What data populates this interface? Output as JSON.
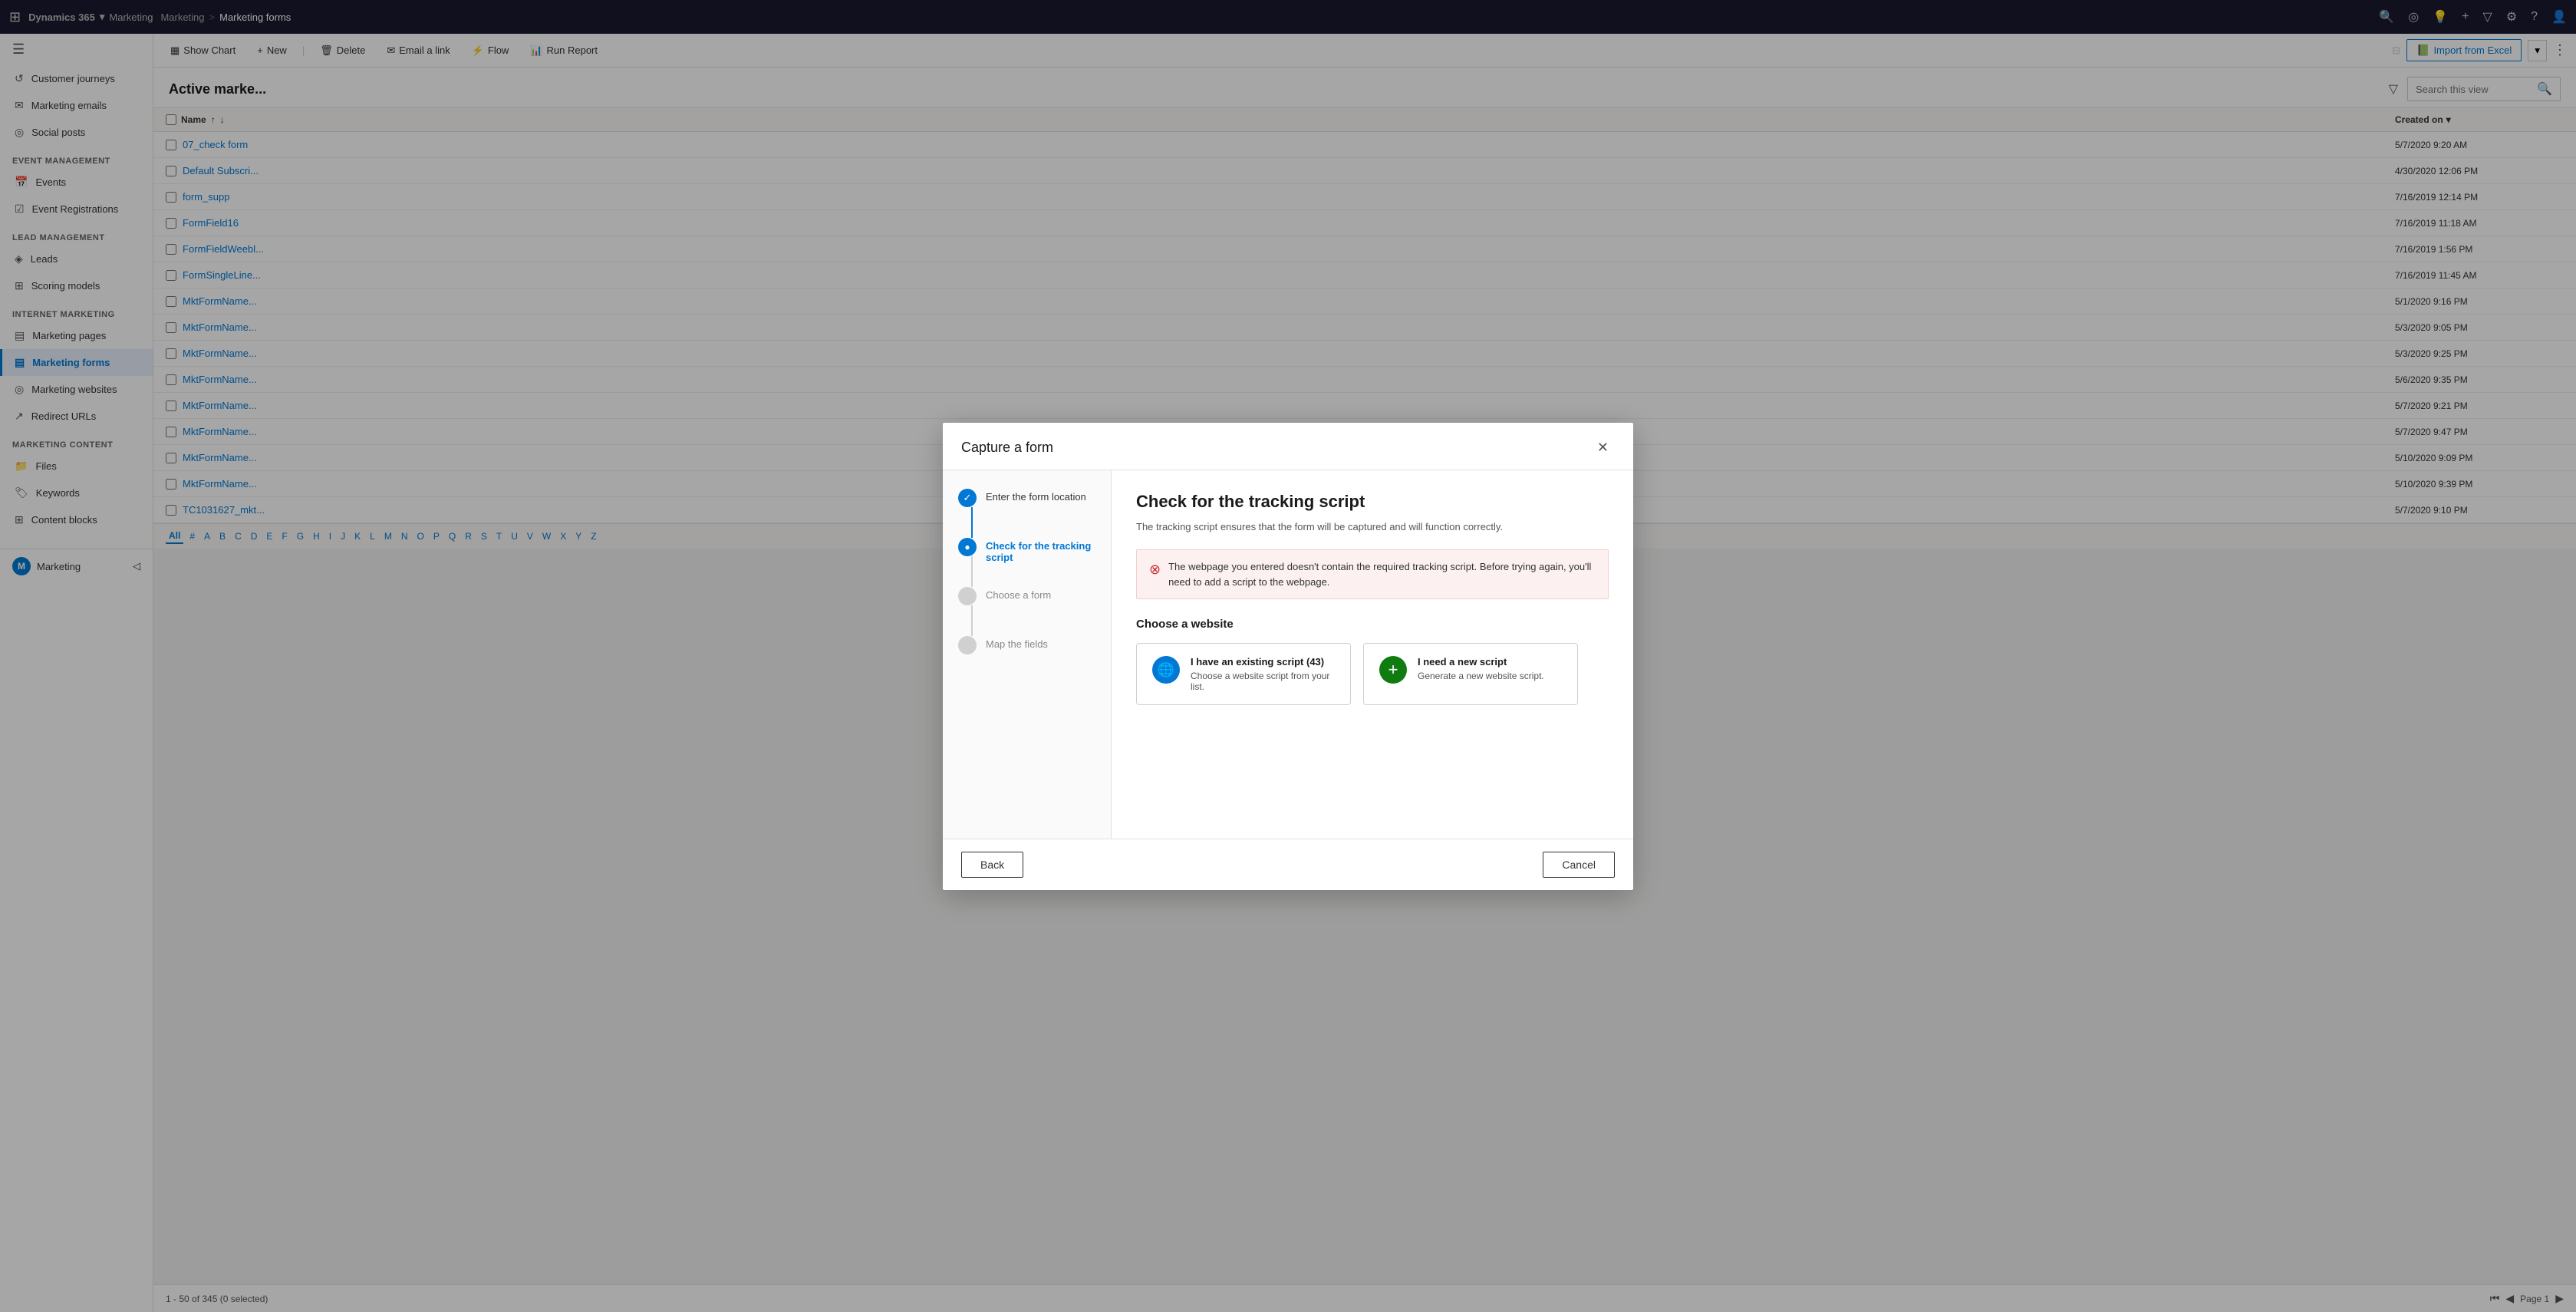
{
  "topnav": {
    "brand": "Dynamics 365",
    "module": "Marketing",
    "breadcrumb_parent": "Marketing",
    "breadcrumb_sep": ">",
    "breadcrumb_current": "Marketing forms"
  },
  "sidebar": {
    "hamburger_label": "☰",
    "sections": [
      {
        "title": "",
        "items": [
          {
            "id": "customer-journeys",
            "icon": "↺",
            "label": "Customer journeys",
            "active": false
          },
          {
            "id": "marketing-emails",
            "icon": "✉",
            "label": "Marketing emails",
            "active": false
          },
          {
            "id": "social-posts",
            "icon": "◎",
            "label": "Social posts",
            "active": false
          }
        ]
      },
      {
        "title": "Event management",
        "items": [
          {
            "id": "events",
            "icon": "📅",
            "label": "Events",
            "active": false
          },
          {
            "id": "event-registrations",
            "icon": "☑",
            "label": "Event Registrations",
            "active": false
          }
        ]
      },
      {
        "title": "Lead management",
        "items": [
          {
            "id": "leads",
            "icon": "◈",
            "label": "Leads",
            "active": false
          },
          {
            "id": "scoring-models",
            "icon": "⊞",
            "label": "Scoring models",
            "active": false
          }
        ]
      },
      {
        "title": "Internet marketing",
        "items": [
          {
            "id": "marketing-pages",
            "icon": "▤",
            "label": "Marketing pages",
            "active": false
          },
          {
            "id": "marketing-forms",
            "icon": "▤",
            "label": "Marketing forms",
            "active": true
          },
          {
            "id": "marketing-websites",
            "icon": "◎",
            "label": "Marketing websites",
            "active": false
          },
          {
            "id": "redirect-urls",
            "icon": "↗",
            "label": "Redirect URLs",
            "active": false
          }
        ]
      },
      {
        "title": "Marketing content",
        "items": [
          {
            "id": "files",
            "icon": "📁",
            "label": "Files",
            "active": false
          },
          {
            "id": "keywords",
            "icon": "🏷",
            "label": "Keywords",
            "active": false
          },
          {
            "id": "content-blocks",
            "icon": "⊞",
            "label": "Content blocks",
            "active": false
          }
        ]
      }
    ]
  },
  "toolbar": {
    "show_chart_label": "Show Chart",
    "new_label": "+",
    "import_excel_label": "Import from Excel"
  },
  "page": {
    "title": "Active marke...",
    "search_placeholder": "Search this view",
    "filter_label": "▽",
    "column_name": "Name",
    "column_created_on": "Created on"
  },
  "table_rows": [
    {
      "name": "07_check form",
      "date": "5/7/2020 9:20 AM"
    },
    {
      "name": "Default Subscri...",
      "date": "4/30/2020 12:06 PM"
    },
    {
      "name": "form_supp",
      "date": "7/16/2019 12:14 PM"
    },
    {
      "name": "FormField16",
      "date": "7/16/2019 11:18 AM"
    },
    {
      "name": "FormFieldWeebl...",
      "date": "7/16/2019 1:56 PM"
    },
    {
      "name": "FormSingleLine...",
      "date": "7/16/2019 11:45 AM"
    },
    {
      "name": "MktFormName...",
      "date": "5/1/2020 9:16 PM"
    },
    {
      "name": "MktFormName...",
      "date": "5/3/2020 9:05 PM"
    },
    {
      "name": "MktFormName...",
      "date": "5/3/2020 9:25 PM"
    },
    {
      "name": "MktFormName...",
      "date": "5/6/2020 9:35 PM"
    },
    {
      "name": "MktFormName...",
      "date": "5/7/2020 9:21 PM"
    },
    {
      "name": "MktFormName...",
      "date": "5/7/2020 9:47 PM"
    },
    {
      "name": "MktFormName...",
      "date": "5/10/2020 9:09 PM"
    },
    {
      "name": "MktFormName...",
      "date": "5/10/2020 9:39 PM"
    },
    {
      "name": "TC1031627_mkt...",
      "date": "5/7/2020 9:10 PM"
    }
  ],
  "alpha_nav": [
    "All",
    "#",
    "A",
    "B",
    "C",
    "D",
    "E",
    "F",
    "G",
    "H",
    "I",
    "J",
    "K",
    "L",
    "M",
    "N",
    "O",
    "P",
    "Q",
    "R",
    "S",
    "T",
    "U",
    "V",
    "W",
    "X",
    "Y",
    "Z"
  ],
  "statusbar": {
    "record_count": "1 - 50 of 345 (0 selected)",
    "page_label": "Page 1"
  },
  "modal": {
    "title": "Capture a form",
    "close_label": "✕",
    "steps": [
      {
        "id": "step-enter-location",
        "label": "Enter the form location",
        "state": "complete"
      },
      {
        "id": "step-check-tracking",
        "label": "Check for the tracking script",
        "state": "active"
      },
      {
        "id": "step-choose-form",
        "label": "Choose a form",
        "state": "inactive"
      },
      {
        "id": "step-map-fields",
        "label": "Map the fields",
        "state": "inactive"
      }
    ],
    "content": {
      "heading": "Check for the tracking script",
      "subtitle": "The tracking script ensures that the form will be captured and will function correctly.",
      "error_message": "The webpage you entered doesn't contain the required tracking script. Before trying again, you'll need to add a script to the webpage.",
      "choose_website_label": "Choose a website",
      "option1": {
        "icon": "🌐",
        "icon_type": "blue",
        "title": "I have an existing script (43)",
        "description": "Choose a website script from your list."
      },
      "option2": {
        "icon": "+",
        "icon_type": "green",
        "title": "I need a new script",
        "description": "Generate a new website script."
      }
    },
    "back_label": "Back",
    "cancel_label": "Cancel"
  }
}
